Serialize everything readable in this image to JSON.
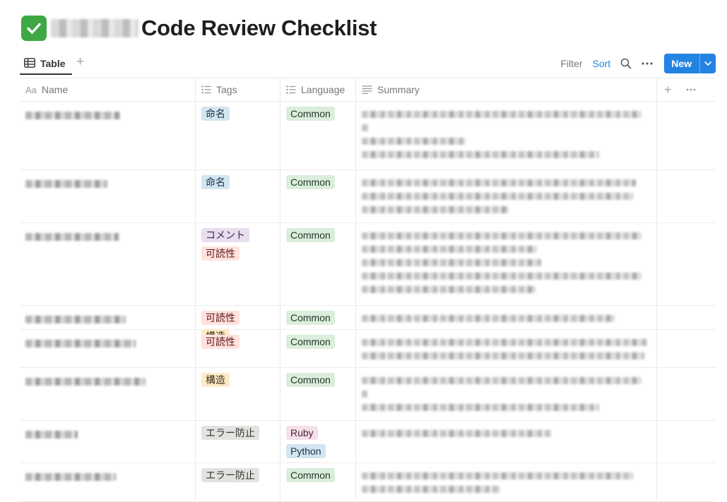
{
  "page": {
    "title_icon": "check-mark-button-icon",
    "title": "Code Review Checklist"
  },
  "viewbar": {
    "tab_label": "Table",
    "add_view_label": "+",
    "filter_label": "Filter",
    "sort_label": "Sort",
    "new_label": "New"
  },
  "columns": {
    "name": "Name",
    "name_prefix": "Aa",
    "tags": "Tags",
    "language": "Language",
    "summary": "Summary",
    "add": "+"
  },
  "rows": [
    {
      "tags": [
        {
          "label": "命名",
          "color": "blue"
        }
      ],
      "languages": [
        {
          "label": "Common",
          "color": "green"
        }
      ]
    },
    {
      "tags": [
        {
          "label": "命名",
          "color": "blue"
        }
      ],
      "languages": [
        {
          "label": "Common",
          "color": "green"
        }
      ]
    },
    {
      "tags": [
        {
          "label": "コメント",
          "color": "purple"
        },
        {
          "label": "可読性",
          "color": "red"
        }
      ],
      "languages": [
        {
          "label": "Common",
          "color": "green"
        }
      ]
    },
    {
      "tags": [
        {
          "label": "可読性",
          "color": "red"
        },
        {
          "label": "構造",
          "color": "yellow"
        }
      ],
      "languages": [
        {
          "label": "Common",
          "color": "green"
        }
      ]
    },
    {
      "tags": [
        {
          "label": "可読性",
          "color": "red"
        }
      ],
      "languages": [
        {
          "label": "Common",
          "color": "green"
        }
      ]
    },
    {
      "tags": [
        {
          "label": "構造",
          "color": "yellow"
        }
      ],
      "languages": [
        {
          "label": "Common",
          "color": "green"
        }
      ]
    },
    {
      "tags": [
        {
          "label": "エラー防止",
          "color": "gray"
        }
      ],
      "languages": [
        {
          "label": "Ruby",
          "color": "pink"
        },
        {
          "label": "Python",
          "color": "blue"
        }
      ]
    },
    {
      "tags": [
        {
          "label": "エラー防止",
          "color": "gray"
        }
      ],
      "languages": [
        {
          "label": "Common",
          "color": "green"
        }
      ]
    }
  ],
  "pill_colors": {
    "blue": {
      "bg": "#d3e5ef",
      "fg": "#183347"
    },
    "green": {
      "bg": "#dbeddb",
      "fg": "#1c3829"
    },
    "purple": {
      "bg": "#e8deee",
      "fg": "#412454"
    },
    "red": {
      "bg": "#ffe2dd",
      "fg": "#5d1715"
    },
    "yellow": {
      "bg": "#fdecc8",
      "fg": "#402c1b"
    },
    "gray": {
      "bg": "#e3e2e0",
      "fg": "#32302c"
    },
    "pink": {
      "bg": "#f5e0e9",
      "fg": "#4c2337"
    }
  },
  "accent": "#2383e2"
}
